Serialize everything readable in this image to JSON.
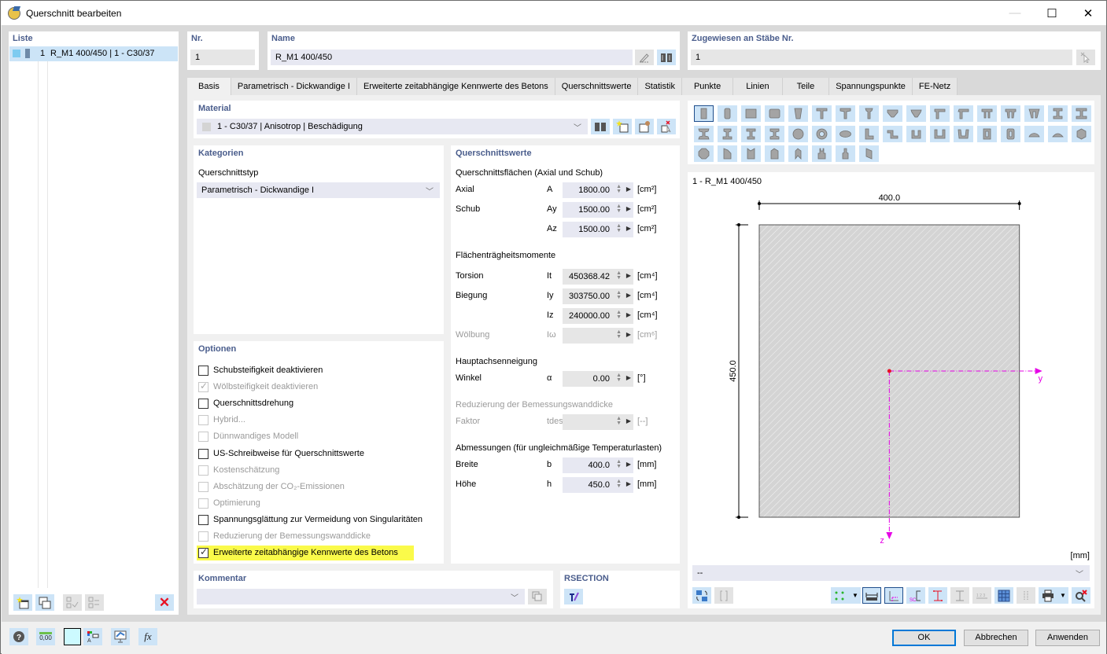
{
  "window": {
    "title": "Querschnitt bearbeiten",
    "controls": {
      "minimize": "—",
      "maximize": "☐",
      "close": "✕"
    }
  },
  "list": {
    "title": "Liste",
    "items": [
      {
        "number": "1",
        "label": "R_M1 400/450 | 1 - C30/37",
        "color": "#7ecbf0",
        "selected": true
      }
    ],
    "buttons": [
      "new-item",
      "copy-item",
      "check-all",
      "check-toggle",
      "delete"
    ]
  },
  "header": {
    "nr_label": "Nr.",
    "nr_value": "1",
    "name_label": "Name",
    "name_value": "R_M1 400/450",
    "assigned_label": "Zugewiesen an Stäbe Nr.",
    "assigned_value": "1"
  },
  "tabs": [
    {
      "label": "Basis",
      "active": true
    },
    {
      "label": "Parametrisch - Dickwandige I"
    },
    {
      "label": "Erweiterte zeitabhängige Kennwerte des Betons"
    },
    {
      "label": "Querschnittswerte"
    },
    {
      "label": "Statistik"
    },
    {
      "label": "Punkte"
    },
    {
      "label": "Linien"
    },
    {
      "label": "Teile"
    },
    {
      "label": "Spannungspunkte"
    },
    {
      "label": "FE-Netz"
    }
  ],
  "material": {
    "title": "Material",
    "value": "1 - C30/37 | Anisotrop | Beschädigung"
  },
  "categories": {
    "title": "Kategorien",
    "type_label": "Querschnittstyp",
    "type_value": "Parametrisch - Dickwandige I"
  },
  "options": {
    "title": "Optionen",
    "items": [
      {
        "label": "Schubsteifigkeit deaktivieren",
        "checked": false,
        "enabled": true
      },
      {
        "label": "Wölbsteifigkeit deaktivieren",
        "checked": true,
        "enabled": false
      },
      {
        "label": "Querschnittsdrehung",
        "checked": false,
        "enabled": true
      },
      {
        "label": "Hybrid...",
        "checked": false,
        "enabled": false
      },
      {
        "label": "Dünnwandiges Modell",
        "checked": false,
        "enabled": false
      },
      {
        "label": "US-Schreibweise für Querschnittswerte",
        "checked": false,
        "enabled": true
      },
      {
        "label": "Kostenschätzung",
        "checked": false,
        "enabled": false
      },
      {
        "label": "Abschätzung der CO₂-Emissionen",
        "checked": false,
        "enabled": false
      },
      {
        "label": "Optimierung",
        "checked": false,
        "enabled": false
      },
      {
        "label": "Spannungsglättung zur Vermeidung von Singularitäten",
        "checked": false,
        "enabled": true
      },
      {
        "label": "Reduzierung der Bemessungswanddicke",
        "checked": false,
        "enabled": false
      },
      {
        "label": "Erweiterte zeitabhängige Kennwerte des Betons",
        "checked": true,
        "enabled": true,
        "highlighted": true
      }
    ]
  },
  "section_values": {
    "title": "Querschnittswerte",
    "areas_title": "Querschnittsflächen (Axial und Schub)",
    "rows_areas": [
      {
        "label": "Axial",
        "symbol": "A",
        "value": "1800.00",
        "unit": "[cm²]"
      },
      {
        "label": "Schub",
        "symbol": "Ay",
        "value": "1500.00",
        "unit": "[cm²]"
      },
      {
        "label": "",
        "symbol": "Az",
        "value": "1500.00",
        "unit": "[cm²]"
      }
    ],
    "moments_title": "Flächenträgheitsmomente",
    "rows_moments": [
      {
        "label": "Torsion",
        "symbol": "It",
        "value": "450368.42",
        "unit": "[cm⁴]"
      },
      {
        "label": "Biegung",
        "symbol": "Iy",
        "value": "303750.00",
        "unit": "[cm⁴]"
      },
      {
        "label": "",
        "symbol": "Iz",
        "value": "240000.00",
        "unit": "[cm⁴]"
      },
      {
        "label": "Wölbung",
        "symbol": "Iω",
        "value": "",
        "unit": "[cm⁶]",
        "disabled": true
      }
    ],
    "axis_title": "Hauptachsenneigung",
    "angle": {
      "label": "Winkel",
      "symbol": "α",
      "value": "0.00",
      "unit": "[°]"
    },
    "reduction_title": "Reduzierung der Bemessungswanddicke",
    "factor": {
      "label": "Faktor",
      "symbol": "tdes/t",
      "value": "",
      "unit": "[--]"
    },
    "dims_title": "Abmessungen (für ungleichmäßige Temperaturlasten)",
    "rows_dims": [
      {
        "label": "Breite",
        "symbol": "b",
        "value": "400.0",
        "unit": "[mm]"
      },
      {
        "label": "Höhe",
        "symbol": "h",
        "value": "450.0",
        "unit": "[mm]"
      }
    ]
  },
  "comment": {
    "title": "Kommentar",
    "value": ""
  },
  "rsection": {
    "title": "RSECTION"
  },
  "preview": {
    "title": "1 - R_M1 400/450",
    "width_dim": "400.0",
    "height_dim": "450.0",
    "axis_y": "y",
    "axis_z": "z",
    "unit": "[mm]",
    "dropdown_value": "--",
    "fill_color": "#d4d4d4",
    "axis_color": "#e600e6"
  },
  "footer": {
    "ok": "OK",
    "cancel": "Abbrechen",
    "apply": "Anwenden",
    "decimal_icon_text": "0,00"
  }
}
